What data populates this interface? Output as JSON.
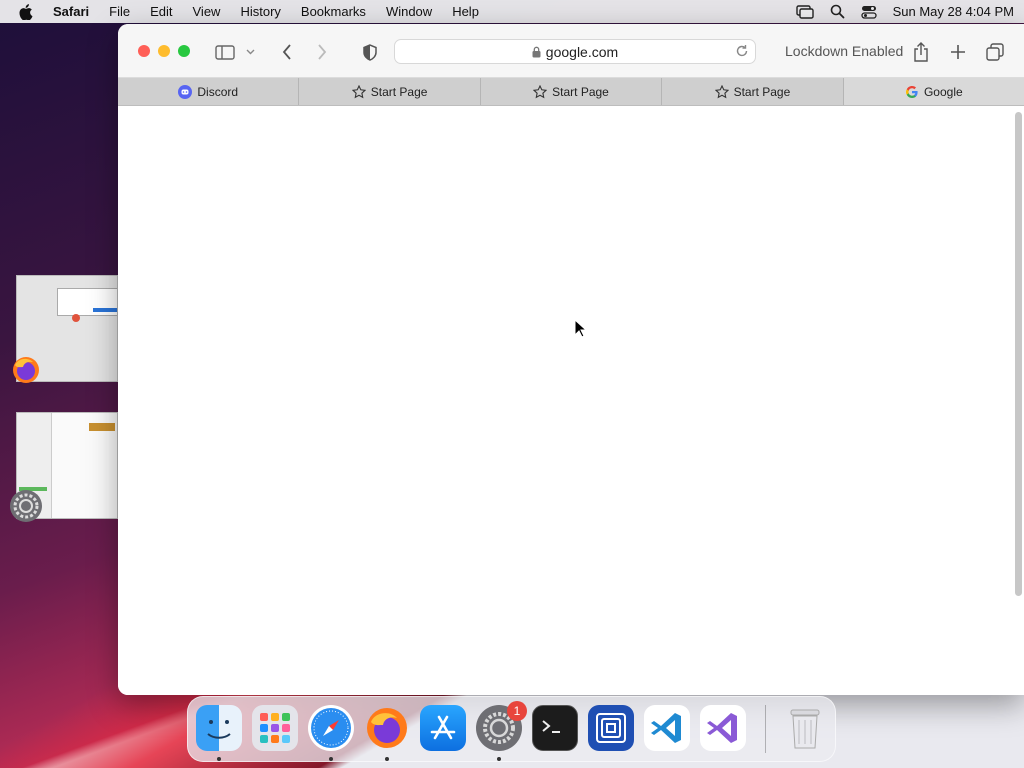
{
  "menubar": {
    "app_name": "Safari",
    "items": [
      "File",
      "Edit",
      "View",
      "History",
      "Bookmarks",
      "Window",
      "Help"
    ],
    "datetime": "Sun May 28  4:04 PM",
    "status_icons": [
      "screen-mirroring-icon",
      "spotlight-search-icon",
      "control-center-icon"
    ]
  },
  "safari": {
    "url": "google.com",
    "lockdown_label": "Lockdown Enabled",
    "tabs": [
      {
        "label": "Discord",
        "icon": "discord-icon"
      },
      {
        "label": "Start Page",
        "icon": "star-icon"
      },
      {
        "label": "Start Page",
        "icon": "star-icon"
      },
      {
        "label": "Start Page",
        "icon": "star-icon"
      },
      {
        "label": "Google",
        "icon": "google-icon"
      }
    ]
  },
  "dock": {
    "apps": [
      "Finder",
      "Launchpad",
      "Safari",
      "Firefox",
      "App Store",
      "System Preferences",
      "Terminal",
      "Simulator",
      "Visual Studio Code",
      "Visual Studio",
      "Trash"
    ],
    "system_preferences_badge": "1"
  },
  "colors": {
    "close": "#ff5f57",
    "minimize": "#febc2e",
    "zoom": "#28c840"
  }
}
